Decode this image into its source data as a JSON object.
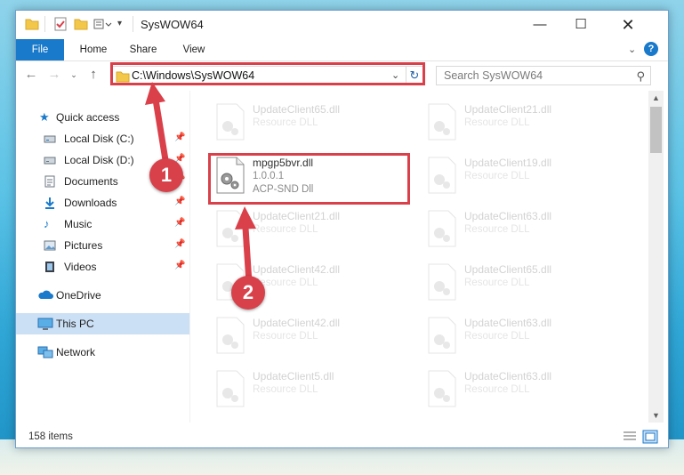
{
  "window": {
    "title": "SysWOW64"
  },
  "ribbon": {
    "tabs": [
      {
        "label": "File"
      },
      {
        "label": "Home"
      },
      {
        "label": "Share"
      },
      {
        "label": "View"
      }
    ]
  },
  "address_bar": {
    "path": "C:\\Windows\\SysWOW64"
  },
  "search": {
    "placeholder": "Search SysWOW64"
  },
  "nav": {
    "quick_access": "Quick access",
    "items": [
      {
        "label": "Local Disk (C:)",
        "icon": "drive-icon"
      },
      {
        "label": "Local Disk (D:)",
        "icon": "drive-icon"
      },
      {
        "label": "Documents",
        "icon": "documents-icon"
      },
      {
        "label": "Downloads",
        "icon": "downloads-icon"
      },
      {
        "label": "Music",
        "icon": "music-icon"
      },
      {
        "label": "Pictures",
        "icon": "pictures-icon"
      },
      {
        "label": "Videos",
        "icon": "videos-icon"
      }
    ],
    "onedrive": "OneDrive",
    "this_pc": "This PC",
    "network": "Network"
  },
  "files": {
    "left": [
      {
        "name": "UpdateClient65.dll",
        "type": "Resource DLL"
      },
      {
        "name": "UpdateClient21.dll",
        "type": "Resource DLL"
      },
      {
        "name": "UpdateClient42.dll",
        "type": "Resource DLL"
      },
      {
        "name": "UpdateClient42.dll",
        "type": "Resource DLL"
      },
      {
        "name": "UpdateClient5.dll",
        "type": "Resource DLL"
      }
    ],
    "right": [
      {
        "name": "UpdateClient21.dll",
        "type": "Resource DLL"
      },
      {
        "name": "UpdateClient19.dll",
        "type": "Resource DLL"
      },
      {
        "name": "UpdateClient63.dll",
        "type": "Resource DLL"
      },
      {
        "name": "UpdateClient65.dll",
        "type": "Resource DLL"
      },
      {
        "name": "UpdateClient63.dll",
        "type": "Resource DLL"
      },
      {
        "name": "UpdateClient63.dll",
        "type": "Resource DLL"
      }
    ],
    "highlighted": {
      "name": "mpgp5bvr.dll",
      "version": "1.0.0.1",
      "description": "ACP-SND Dll"
    }
  },
  "status": {
    "item_count": "158 items"
  },
  "annotations": {
    "badge1": "1",
    "badge2": "2",
    "color": "#d9404a"
  }
}
